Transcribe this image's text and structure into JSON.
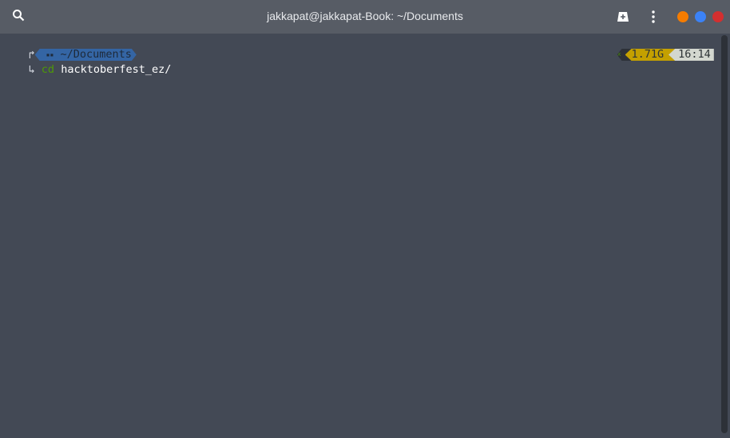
{
  "window": {
    "title": "jakkapat@jakkapat-Book: ~/Documents"
  },
  "icons": {
    "search": "search-icon",
    "new_tab": "new-tab-icon",
    "menu": "more-vert-icon"
  },
  "controls": {
    "minimize": "#f57c00",
    "maximize": "#3b82f6",
    "close": "#d32f2f"
  },
  "prompt": {
    "top_arrow": "↱",
    "dir_icon": "▪▪",
    "cwd": "~/Documents",
    "bottom_arrow": "↳",
    "command": "cd",
    "argument": "hacktoberfest_ez/",
    "memory": "1.71G",
    "time": "16:14",
    "colors": {
      "cwd_bg": "#3465a4",
      "mem_bg": "#c4a000",
      "time_bg": "#d3d7cf",
      "cmd": "#4e9a06"
    }
  }
}
